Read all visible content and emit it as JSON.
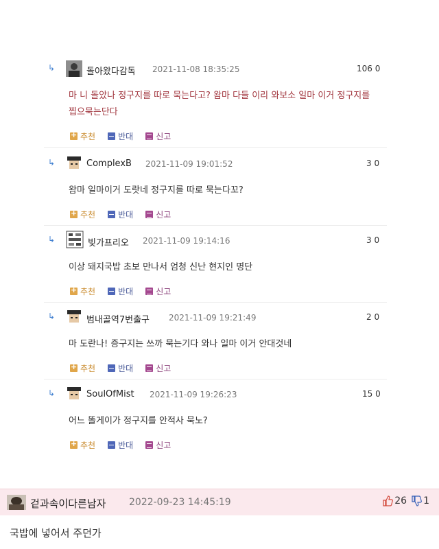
{
  "replies": [
    {
      "nick": "돌아왔다감독",
      "date": "2021-11-08 18:35:25",
      "score": "106 0",
      "text": "마 니 돌았나 정구지를 따로 묵는다고? 왐마 다들 이리 와보소 일마 이거 정구지를 찝으묵는단다",
      "text_color": "#a2373f"
    },
    {
      "nick": "ComplexB",
      "date": "2021-11-09 19:01:52",
      "score": "3 0",
      "text": "왐마 일마이거 도랏네 정구지를 따로 묵는다꼬?",
      "text_color": "#333333"
    },
    {
      "nick": "빚가프리오",
      "date": "2021-11-09 19:14:16",
      "score": "3 0",
      "text": "이상 돼지국밥 초보 만나서 엄청 신난 현지인 명단",
      "text_color": "#333333"
    },
    {
      "nick": "범내골역7번출구",
      "date": "2021-11-09 19:21:49",
      "score": "2 0",
      "text": "마 도란나! 증구지는 쓰까 묵는기다 와나 일마 이거 안대것네",
      "text_color": "#333333"
    },
    {
      "nick": "SoulOfMist",
      "date": "2021-11-09 19:26:23",
      "score": "15 0",
      "text": "어느 똘게이가 정구지를 안적사 묵노?",
      "text_color": "#333333"
    }
  ],
  "actions": {
    "upvote": "추천",
    "downvote": "반대",
    "report": "신고"
  },
  "main_comment": {
    "nick": "겉과속이다른남자",
    "date": "2022-09-23 14:45:19",
    "likes": "26",
    "dislikes": "1",
    "text": "국밥에 넣어서 주던가"
  },
  "colors": {
    "upvote": "#e0a64a",
    "downvote": "#4f67b8",
    "report": "#a4488f",
    "main_header_bg": "#fbe9ed",
    "highlight_text": "#a2373f"
  },
  "icons": {
    "reply": "reply-arrow-icon",
    "upvote": "plus-box-icon",
    "downvote": "minus-box-icon",
    "report": "report-box-icon",
    "like": "thumbs-up-icon",
    "dislike": "thumbs-down-icon"
  }
}
